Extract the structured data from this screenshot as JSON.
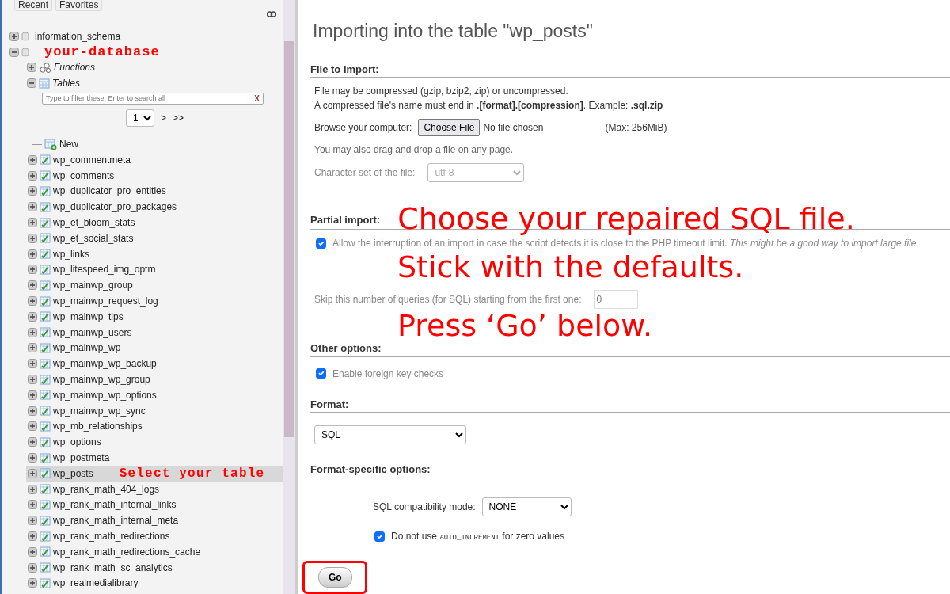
{
  "sidebar": {
    "tabs": [
      {
        "label": "Recent"
      },
      {
        "label": "Favorites"
      }
    ],
    "tree": [
      {
        "kind": "database",
        "label": "information_schema",
        "expanded": false,
        "annotated": false
      },
      {
        "kind": "database",
        "label": "your-database",
        "expanded": true,
        "annotated": true,
        "children": [
          {
            "kind": "functions",
            "label": "Functions",
            "expanded": false
          },
          {
            "kind": "tables",
            "label": "Tables",
            "expanded": true,
            "filter_placeholder": "Type to filter these, Enter to search all",
            "filter_clear": "X",
            "page": "1",
            "next": ">",
            "last": ">>",
            "children": [
              {
                "kind": "new",
                "label": "New"
              },
              {
                "kind": "table",
                "label": "wp_commentmeta",
                "selected": false
              },
              {
                "kind": "table",
                "label": "wp_comments",
                "selected": false
              },
              {
                "kind": "table",
                "label": "wp_duplicator_pro_entities",
                "selected": false
              },
              {
                "kind": "table",
                "label": "wp_duplicator_pro_packages",
                "selected": false
              },
              {
                "kind": "table",
                "label": "wp_et_bloom_stats",
                "selected": false
              },
              {
                "kind": "table",
                "label": "wp_et_social_stats",
                "selected": false
              },
              {
                "kind": "table",
                "label": "wp_links",
                "selected": false
              },
              {
                "kind": "table",
                "label": "wp_litespeed_img_optm",
                "selected": false
              },
              {
                "kind": "table",
                "label": "wp_mainwp_group",
                "selected": false
              },
              {
                "kind": "table",
                "label": "wp_mainwp_request_log",
                "selected": false
              },
              {
                "kind": "table",
                "label": "wp_mainwp_tips",
                "selected": false
              },
              {
                "kind": "table",
                "label": "wp_mainwp_users",
                "selected": false
              },
              {
                "kind": "table",
                "label": "wp_mainwp_wp",
                "selected": false
              },
              {
                "kind": "table",
                "label": "wp_mainwp_wp_backup",
                "selected": false
              },
              {
                "kind": "table",
                "label": "wp_mainwp_wp_group",
                "selected": false
              },
              {
                "kind": "table",
                "label": "wp_mainwp_wp_options",
                "selected": false
              },
              {
                "kind": "table",
                "label": "wp_mainwp_wp_sync",
                "selected": false
              },
              {
                "kind": "table",
                "label": "wp_mb_relationships",
                "selected": false
              },
              {
                "kind": "table",
                "label": "wp_options",
                "selected": false
              },
              {
                "kind": "table",
                "label": "wp_postmeta",
                "selected": false
              },
              {
                "kind": "table",
                "label": "wp_posts",
                "selected": true,
                "note": "Select your table"
              },
              {
                "kind": "table",
                "label": "wp_rank_math_404_logs",
                "selected": false
              },
              {
                "kind": "table",
                "label": "wp_rank_math_internal_links",
                "selected": false
              },
              {
                "kind": "table",
                "label": "wp_rank_math_internal_meta",
                "selected": false
              },
              {
                "kind": "table",
                "label": "wp_rank_math_redirections",
                "selected": false
              },
              {
                "kind": "table",
                "label": "wp_rank_math_redirections_cache",
                "selected": false
              },
              {
                "kind": "table",
                "label": "wp_rank_math_sc_analytics",
                "selected": false
              },
              {
                "kind": "table",
                "label": "wp_realmedialibrary",
                "selected": false
              }
            ]
          }
        ]
      }
    ]
  },
  "main": {
    "title": "Importing into the table \"wp_posts\"",
    "file_to_import": {
      "heading": "File to import:",
      "notes": [
        "File may be compressed (gzip, bzip2, zip) or uncompressed.",
        "A compressed file's name must end in **.[format].[compression]**. Example: **.sql.zip**"
      ],
      "browse_label": "Browse your computer:",
      "choose_button": "Choose File",
      "no_file": "No file chosen",
      "max": "(Max: 256MiB)",
      "drag_note": "You may also drag and drop a file on any page.",
      "charset_label": "Character set of the file:",
      "charset_value": "utf-8",
      "charset_disabled": true
    },
    "partial_import": {
      "heading": "Partial import:",
      "allow_label": "Allow the interruption of an import in case the script detects it is close to the PHP timeout limit. *This might be a good way to import large file*",
      "allow_checked": true,
      "skip_label": "Skip this number of queries (for SQL) starting from the first one:",
      "skip_value": "0"
    },
    "other_options": {
      "heading": "Other options:",
      "foreign_label": "Enable foreign key checks",
      "foreign_checked": true
    },
    "format": {
      "heading": "Format:",
      "value": "SQL"
    },
    "format_specific": {
      "heading": "Format-specific options:",
      "compat_label": "SQL compatibility mode:",
      "compat_value": "NONE",
      "auto_before": "Do not use",
      "auto_code": "AUTO_INCREMENT",
      "auto_after": "for zero values",
      "auto_checked": true
    },
    "go_button": {
      "label": "Go",
      "highlighted": true
    }
  },
  "annotations": [
    "Choose your repaired SQL file.",
    "Stick with the defaults.",
    "Press ‘Go’ below."
  ]
}
